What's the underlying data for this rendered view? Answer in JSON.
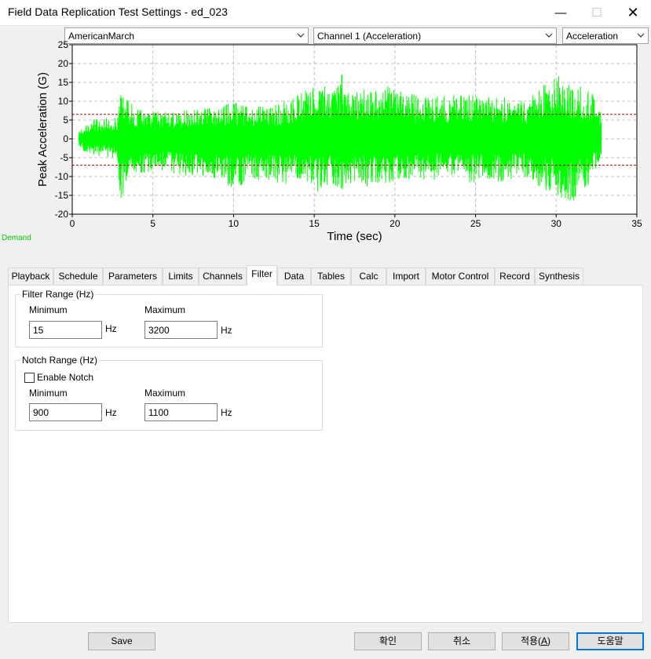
{
  "window": {
    "title": "Field Data Replication Test Settings - ed_023",
    "controls": {
      "minimize": "—",
      "maximize": "☐",
      "close": "✕"
    }
  },
  "selectors": {
    "profile": "AmericanMarch",
    "channel": "Channel 1 (Acceleration)",
    "measure": "Acceleration"
  },
  "legend": {
    "demand": "Demand"
  },
  "chart_data": {
    "type": "line",
    "title": "",
    "xlabel": "Time (sec)",
    "ylabel": "Peak Acceleration (G)",
    "xlim": [
      0,
      35
    ],
    "ylim": [
      -20,
      25
    ],
    "x_ticks": [
      "0",
      "5",
      "10",
      "15",
      "20",
      "25",
      "30",
      "35"
    ],
    "y_ticks": [
      "25",
      "20",
      "15",
      "10",
      "5",
      "0",
      "-5",
      "-10",
      "-15",
      "-20"
    ],
    "grid": true,
    "series": [
      {
        "name": "Demand",
        "color": "#00ff00",
        "x_range": [
          0.4,
          32.8
        ],
        "envelope_x": [
          0.4,
          1,
          2,
          2.8,
          3,
          3.3,
          4,
          5,
          6,
          7,
          8,
          9,
          10,
          11,
          12,
          13,
          14,
          15,
          15.3,
          16,
          16.6,
          17,
          18,
          19,
          20,
          21,
          22,
          23,
          24,
          25,
          26,
          27,
          28,
          29,
          30,
          31,
          32,
          32.8
        ],
        "envelope_upper": [
          2,
          5,
          5.5,
          6,
          15,
          11,
          8,
          8,
          7,
          8,
          8,
          9,
          10,
          9,
          9,
          10,
          12,
          14,
          17,
          12,
          19,
          13,
          13,
          14,
          14,
          12,
          11,
          12,
          12,
          12,
          11,
          12,
          10,
          14,
          17,
          15,
          14,
          7
        ],
        "envelope_lower": [
          -2,
          -4.5,
          -5,
          -5,
          -18,
          -14,
          -9,
          -9,
          -9,
          -10,
          -10,
          -11,
          -14,
          -11,
          -11,
          -12,
          -12,
          -12,
          -15,
          -12,
          -14,
          -13,
          -13,
          -12,
          -12,
          -11,
          -11,
          -11,
          -11,
          -12,
          -11,
          -12,
          -10,
          -13,
          -15,
          -17,
          -13,
          -5
        ]
      }
    ],
    "limit_lines": [
      {
        "value": 6.5,
        "color": "#b00000",
        "style": "dashed"
      },
      {
        "value": -7,
        "color": "#b00000",
        "style": "dashed"
      }
    ]
  },
  "tabs": [
    {
      "label": "Playback",
      "active": false
    },
    {
      "label": "Schedule",
      "active": false
    },
    {
      "label": "Parameters",
      "active": false
    },
    {
      "label": "Limits",
      "active": false
    },
    {
      "label": "Channels",
      "active": false
    },
    {
      "label": "Filter",
      "active": true
    },
    {
      "label": "Data",
      "active": false
    },
    {
      "label": "Tables",
      "active": false
    },
    {
      "label": "Calc",
      "active": false
    },
    {
      "label": "Import",
      "active": false
    },
    {
      "label": "Motor Control",
      "active": false
    },
    {
      "label": "Record",
      "active": false
    },
    {
      "label": "Synthesis",
      "active": false
    }
  ],
  "filter_range": {
    "title": "Filter Range (Hz)",
    "min_label": "Minimum",
    "max_label": "Maximum",
    "min_value": "15",
    "max_value": "3200",
    "unit": "Hz"
  },
  "notch_range": {
    "title": "Notch Range (Hz)",
    "enable_label": "Enable Notch",
    "enabled": false,
    "min_label": "Minimum",
    "max_label": "Maximum",
    "min_value": "900",
    "max_value": "1100",
    "unit": "Hz"
  },
  "buttons": {
    "save": "Save",
    "ok": "확인",
    "cancel": "취소",
    "apply_prefix": "적용(",
    "apply_key": "A",
    "apply_suffix": ")",
    "help": "도움말"
  }
}
